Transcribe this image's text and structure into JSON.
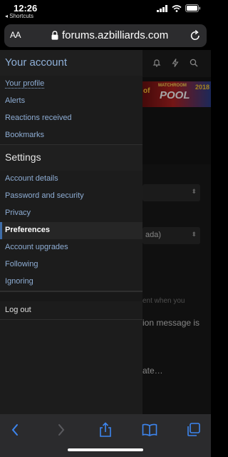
{
  "status_bar": {
    "time": "12:26",
    "back_app": "◂ Shortcuts"
  },
  "url_bar": {
    "text_size_label": "AA",
    "url": "forums.azbilliards.com"
  },
  "banner": {
    "left_fragment": "of",
    "line1": "MATCHROOM",
    "line2": "POOL",
    "year": "2018"
  },
  "background": {
    "select2_text": "ada)",
    "line1": "ent when you",
    "line2": "ion message is",
    "line3": "ate…"
  },
  "menu": {
    "account_title": "Your account",
    "account_items": [
      {
        "label": "Your profile"
      },
      {
        "label": "Alerts"
      },
      {
        "label": "Reactions received"
      },
      {
        "label": "Bookmarks"
      }
    ],
    "settings_title": "Settings",
    "settings_items": [
      {
        "label": "Account details"
      },
      {
        "label": "Password and security"
      },
      {
        "label": "Privacy"
      },
      {
        "label": "Preferences",
        "active": true
      },
      {
        "label": "Account upgrades"
      },
      {
        "label": "Following"
      },
      {
        "label": "Ignoring"
      }
    ],
    "logout_label": "Log out"
  },
  "colors": {
    "link": "#8eadd4",
    "active_marker": "#3f6da8",
    "toolbar_icon": "#3d86f0"
  }
}
